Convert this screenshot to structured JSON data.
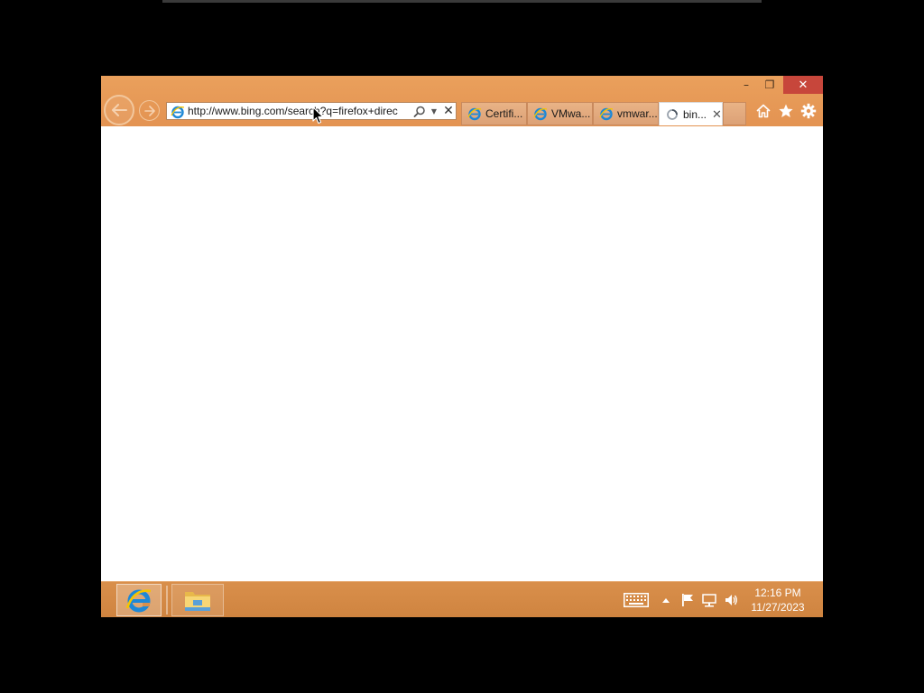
{
  "browser": {
    "window_controls": {
      "minimize": "–",
      "restore": "❐",
      "close": "✕"
    },
    "address_bar": {
      "url": "http://www.bing.com/search?q=firefox+direc",
      "icon": "ie-page-icon"
    },
    "tabs": [
      {
        "label": "Certifi...",
        "icon": "ie-page-icon",
        "active": false
      },
      {
        "label": "VMwa...",
        "icon": "ie-page-icon",
        "active": false
      },
      {
        "label": "vmwar...",
        "icon": "ie-page-icon",
        "active": false
      },
      {
        "label": "bin...",
        "icon": "loading-spinner-icon",
        "active": true,
        "close": "✕"
      }
    ],
    "command_icons": [
      "home-icon",
      "favorites-star-icon",
      "tools-gear-icon"
    ]
  },
  "taskbar": {
    "pinned": [
      {
        "name": "internet-explorer",
        "active": true
      },
      {
        "name": "file-explorer",
        "active": false
      }
    ],
    "tray_icons": [
      "touch-keyboard-icon",
      "show-hidden-icons-icon",
      "action-center-flag-icon",
      "network-icon",
      "volume-icon"
    ],
    "clock": {
      "time": "12:16 PM",
      "date": "11/27/2023"
    }
  },
  "colors": {
    "chrome_orange": "#e39352",
    "taskbar_orange": "#d98f4b",
    "close_red": "#c7463b",
    "ie_blue": "#1e88d6",
    "ie_yellow": "#f5c400"
  }
}
